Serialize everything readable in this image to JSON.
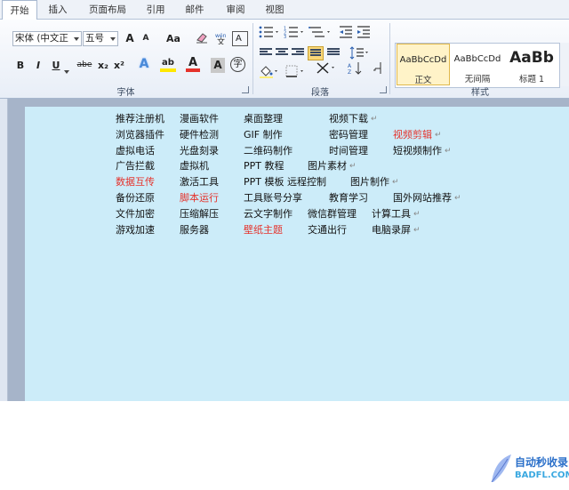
{
  "tabs": [
    "开始",
    "插入",
    "页面布局",
    "引用",
    "邮件",
    "审阅",
    "视图"
  ],
  "font": {
    "family_value": "宋体 (中文正",
    "size_value": "五号",
    "grow": "A",
    "shrink": "A",
    "change_case": "Aa",
    "bold": "B",
    "italic": "I",
    "underline": "U",
    "strike": "abe",
    "subscript": "x₂",
    "superscript": "x²",
    "text_effect": "A",
    "highlight": "ab",
    "font_color": "A",
    "char_shading": "A",
    "enclose": "字",
    "group_label": "字体"
  },
  "paragraph": {
    "group_label": "段落"
  },
  "styles": {
    "items": [
      {
        "preview": "AaBbCcDd",
        "name": "正文"
      },
      {
        "preview": "AaBbCcDd",
        "name": "无间隔"
      },
      {
        "preview": "AaBb",
        "name": "标题 1"
      }
    ],
    "group_label": "样式"
  },
  "document": {
    "rows": [
      [
        "推荐注册机",
        "漫画软件",
        "桌面整理",
        "视频下载"
      ],
      [
        "浏览器插件",
        "硬件检测",
        "GIF 制作",
        "密码管理",
        "视频剪辑"
      ],
      [
        "虚拟电话",
        "光盘刻录",
        "二维码制作",
        "时间管理",
        "短视频制作"
      ],
      [
        "广告拦截",
        "虚拟机",
        "PPT 教程",
        "图片素材"
      ],
      [
        "数据互传",
        "激活工具",
        "PPT 模板 远程控制",
        "图片制作"
      ],
      [
        "备份还原",
        "脚本运行",
        "工具账号分享",
        "教育学习",
        "国外网站推荐"
      ],
      [
        "文件加密",
        "压缩解压",
        "云文字制作",
        "微信群管理",
        "计算工具"
      ],
      [
        "游戏加速",
        "服务器",
        "壁纸主题",
        "交通出行",
        "电脑录屏"
      ]
    ],
    "paragraph_mark": "↵"
  },
  "watermark": {
    "title": "自动秒收录",
    "url": "BADFL.COM"
  },
  "colors": {
    "accent_red": "#e5322b",
    "page_bg": "#ccecf9"
  }
}
